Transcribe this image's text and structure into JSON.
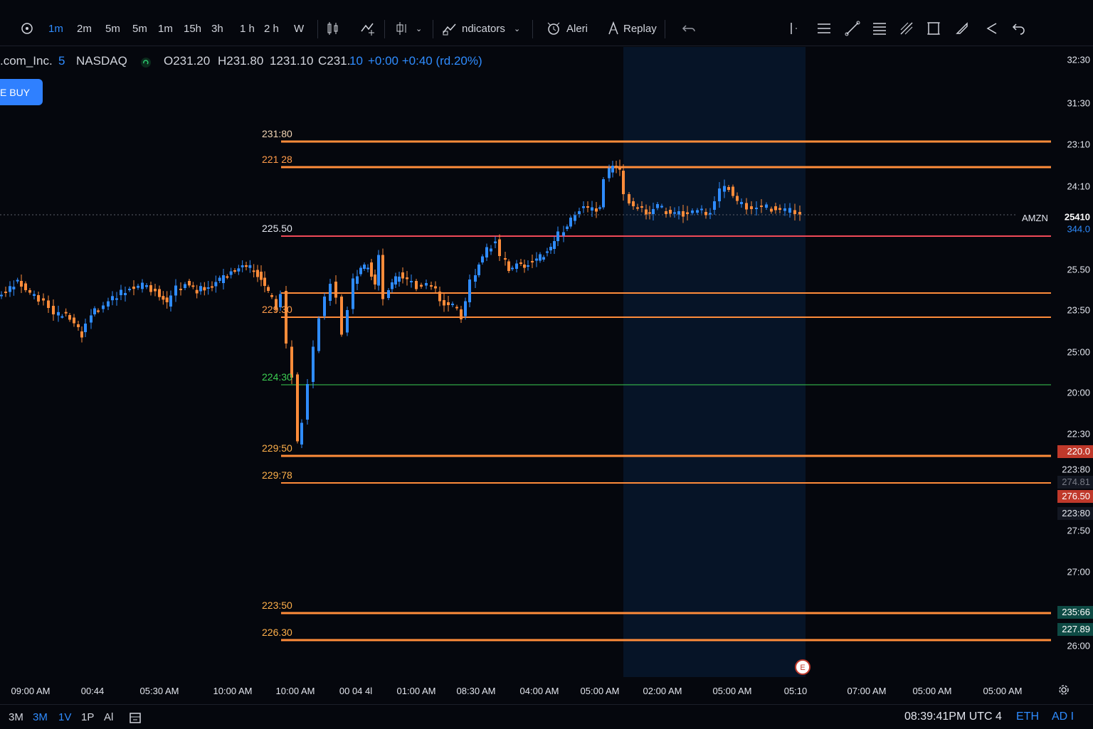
{
  "toolbar": {
    "intervals": [
      {
        "label": "1m",
        "active": true
      },
      {
        "label": "2m",
        "active": false
      },
      {
        "label": "5m",
        "active": false
      },
      {
        "label": "5m",
        "active": false
      },
      {
        "label": "1m",
        "active": false
      },
      {
        "label": "15h",
        "active": false
      },
      {
        "label": "3h",
        "active": false
      },
      {
        "label": "1 h",
        "active": false
      },
      {
        "label": "2 h",
        "active": false
      },
      {
        "label": "W",
        "active": false
      }
    ],
    "indicators_label": "ndicators",
    "alert_label": "Aleri",
    "replay_label": "Replay"
  },
  "legend": {
    "symbol": ".com_Inc.",
    "interval": "5",
    "exchange": "NASDAQ",
    "open": "O231.20",
    "high": "H231.80",
    "low": "1231.10",
    "close_prefix": "C231.",
    "close_suffix": "10",
    "change": "+0:00 +0:40 (rd.20%)"
  },
  "buy_button": "E BUY",
  "price_lines": [
    {
      "label": "231:80",
      "color": "#ff8c3a",
      "label_color": "#f2d5b5"
    },
    {
      "label": "221 28",
      "color": "#ff8c3a",
      "label_color": "#ff9b4a"
    },
    {
      "label": "225.50",
      "color": "#f04a58",
      "label_color": "#e3e6ee"
    },
    {
      "label": "",
      "color": "#ff8c3a",
      "label_color": "#ff9b4a"
    },
    {
      "label": "229.30",
      "color": "#ff8c3a",
      "label_color": "#ff9b4a"
    },
    {
      "label": "224:30",
      "color": "#3ccf52",
      "label_color": "#3ccf52"
    },
    {
      "label": "229:50",
      "color": "#ff8c3a",
      "label_color": "#ffb04a"
    },
    {
      "label": "229:78",
      "color": "#ff8c3a",
      "label_color": "#ffb04a"
    },
    {
      "label": "223:50",
      "color": "#ff8c3a",
      "label_color": "#ffb04a"
    },
    {
      "label": "226.30",
      "color": "#ff8c3a",
      "label_color": "#ffb04a"
    }
  ],
  "right_axis": {
    "ticks": [
      "32:30",
      "31:30",
      "23:10",
      "24:10",
      "25.50",
      "23:50",
      "25:00",
      "20:00",
      "22:30",
      "223:80",
      "27:50",
      "27:00",
      "26:00"
    ],
    "last_price": "25410",
    "last_sub": "344.0",
    "symbol_tag": "AMZN",
    "badges": [
      {
        "text": "220.0",
        "bg": "#c0392b",
        "fg": "#ffffff"
      },
      {
        "text": "274.81",
        "bg": "#131722",
        "fg": "#787b86"
      },
      {
        "text": "276.50",
        "bg": "#c0392b",
        "fg": "#ffffff"
      },
      {
        "text": "223:80",
        "bg": "#131722",
        "fg": "#e3e6ee"
      },
      {
        "text": "235:66",
        "bg": "#0e4a44",
        "fg": "#ffffff"
      },
      {
        "text": "227.89",
        "bg": "#0e4a44",
        "fg": "#ffffff"
      }
    ]
  },
  "time_axis": [
    "09:00 AM",
    "00:44",
    "05:30 AM",
    "10:00 AM",
    "10:00 AM",
    "00 04 4l",
    "01:00 AM",
    "08:30 AM",
    "04:00 AM",
    "05:00 AM",
    "02:00 AM",
    "05:00 AM",
    "05:10",
    "07:00 AM",
    "05:00 AM",
    "05:00 AM"
  ],
  "bottom_bar": {
    "ranges": [
      {
        "label": "3M",
        "active": false
      },
      {
        "label": "3M",
        "active": true
      },
      {
        "label": "1V",
        "active": true
      },
      {
        "label": "1P",
        "active": false
      },
      {
        "label": "Al",
        "active": false
      }
    ],
    "clock": "08:39:41PM UTC 4",
    "session": "ETH",
    "adj": "AD I"
  },
  "colors": {
    "up": "#2f8cff",
    "down": "#ff8c3a",
    "background": "#05070d"
  }
}
